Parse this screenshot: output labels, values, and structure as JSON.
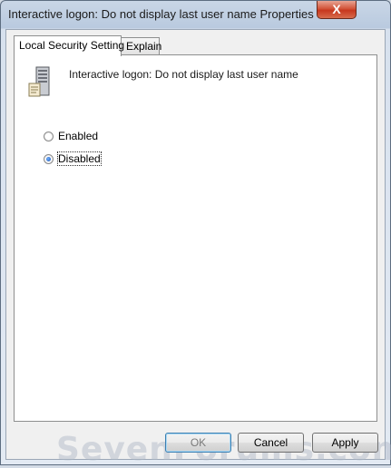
{
  "window": {
    "title": "Interactive logon: Do not display last user name Properties",
    "close_glyph": "X"
  },
  "tabs": [
    {
      "label": "Local Security Setting",
      "active": true
    },
    {
      "label": "Explain",
      "active": false
    }
  ],
  "policy": {
    "icon": "server-icon",
    "name": "Interactive logon: Do not display last user name"
  },
  "options": [
    {
      "label": "Enabled",
      "checked": false
    },
    {
      "label": "Disabled",
      "checked": true
    }
  ],
  "watermark": "SevenForums.com",
  "buttons": {
    "ok": "OK",
    "cancel": "Cancel",
    "apply": "Apply"
  }
}
